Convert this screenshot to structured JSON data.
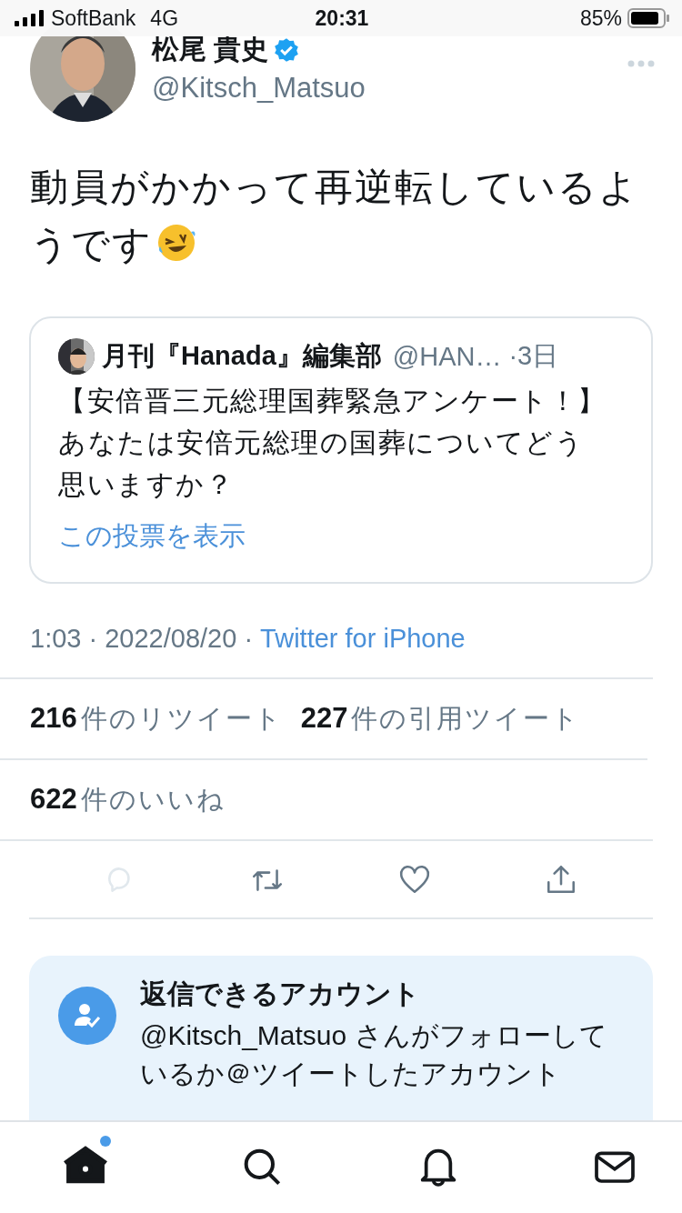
{
  "status_bar": {
    "carrier": "SoftBank",
    "network": "4G",
    "time": "20:31",
    "battery": "85%"
  },
  "author": {
    "name": "松尾 貴史",
    "verified": true,
    "handle": "@Kitsch_Matsuo"
  },
  "tweet": {
    "text": "動員がかかって再逆転しているようです"
  },
  "quoted_tweet": {
    "name": "月刊『Hanada』編集部",
    "handle": "@HAN…",
    "time": "·3日",
    "text": "【安倍晋三元総理国葬緊急アンケート！】あなたは安倍元総理の国葬についてどう思いますか？",
    "link": "この投票を表示"
  },
  "meta": {
    "timestamp": "1:03 · 2022/08/20 ·",
    "source": "Twitter for iPhone"
  },
  "stats": [
    {
      "count": "216",
      "label": "件のリツイート"
    },
    {
      "count": "227",
      "label": "件の引用ツイート"
    },
    {
      "count": "622",
      "label": "件のいいね"
    }
  ],
  "actions": [
    {
      "kind": "reply",
      "disabled": true
    },
    {
      "kind": "retweet",
      "disabled": false
    },
    {
      "kind": "like",
      "disabled": false
    },
    {
      "kind": "share",
      "disabled": false
    }
  ],
  "reply_notice": {
    "title": "返信できるアカウント",
    "text": "@Kitsch_Matsuo さんがフォローしているか＠ツイートしたアカウント"
  },
  "tabs": [
    {
      "kind": "home",
      "selected": true,
      "unread": true
    },
    {
      "kind": "search",
      "selected": false,
      "unread": false
    },
    {
      "kind": "notifications",
      "selected": false,
      "unread": false
    },
    {
      "kind": "messages",
      "selected": false,
      "unread": false
    }
  ]
}
